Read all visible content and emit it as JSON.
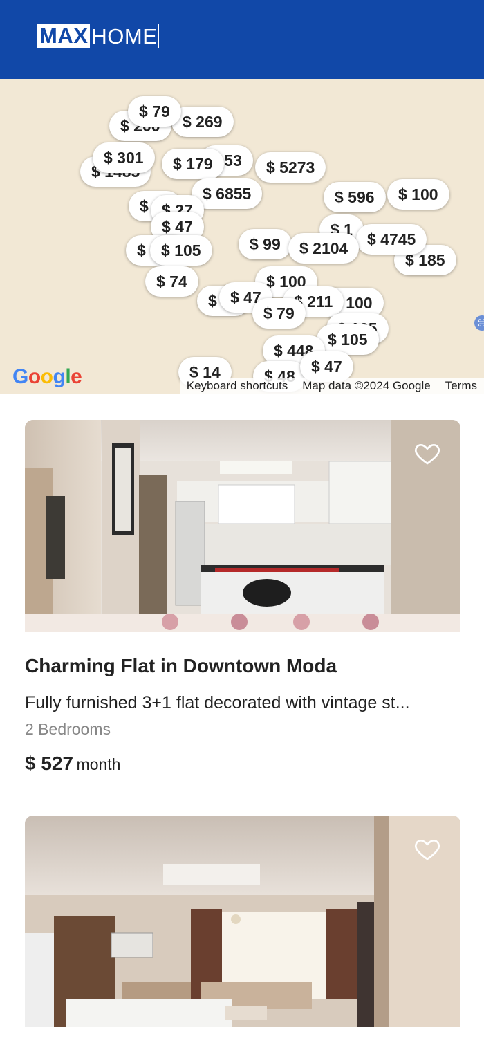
{
  "header": {
    "logo_left": "MAX",
    "logo_right": "HOME",
    "bg_color": "#1148a8"
  },
  "map": {
    "pins": [
      "$ 200",
      "$ 79",
      "$ 269",
      "$ 1485",
      "$ 301",
      "$ 179",
      "$ 53",
      "$ 5273",
      "$ 6855",
      "$ 596",
      "$ 100",
      "$ 67",
      "$ 27",
      "$ 47",
      "$ 1",
      "$ 4745",
      "$ 105",
      "$ 99",
      "$ 2104",
      "$ 185",
      "$ 74",
      "$ 100",
      "$ 211",
      "$ 47",
      "$ 79",
      "$ 105",
      "$ 448",
      "$ 105",
      "$ 47",
      "$ 14",
      "$ 48"
    ],
    "google_logo": [
      "G",
      "o",
      "o",
      "g",
      "l",
      "e"
    ],
    "footer": {
      "shortcuts": "Keyboard shortcuts",
      "data": "Map data ©2024 Google",
      "terms": "Terms"
    }
  },
  "listings": [
    {
      "title": "Charming Flat in Downtown Moda",
      "description": "Fully furnished 3+1 flat decorated with vintage st...",
      "bedrooms": "2 Bedrooms",
      "price": "$ 527",
      "period": "month",
      "favorite_icon": "heart-outline-icon"
    },
    {
      "favorite_icon": "heart-outline-icon"
    }
  ]
}
